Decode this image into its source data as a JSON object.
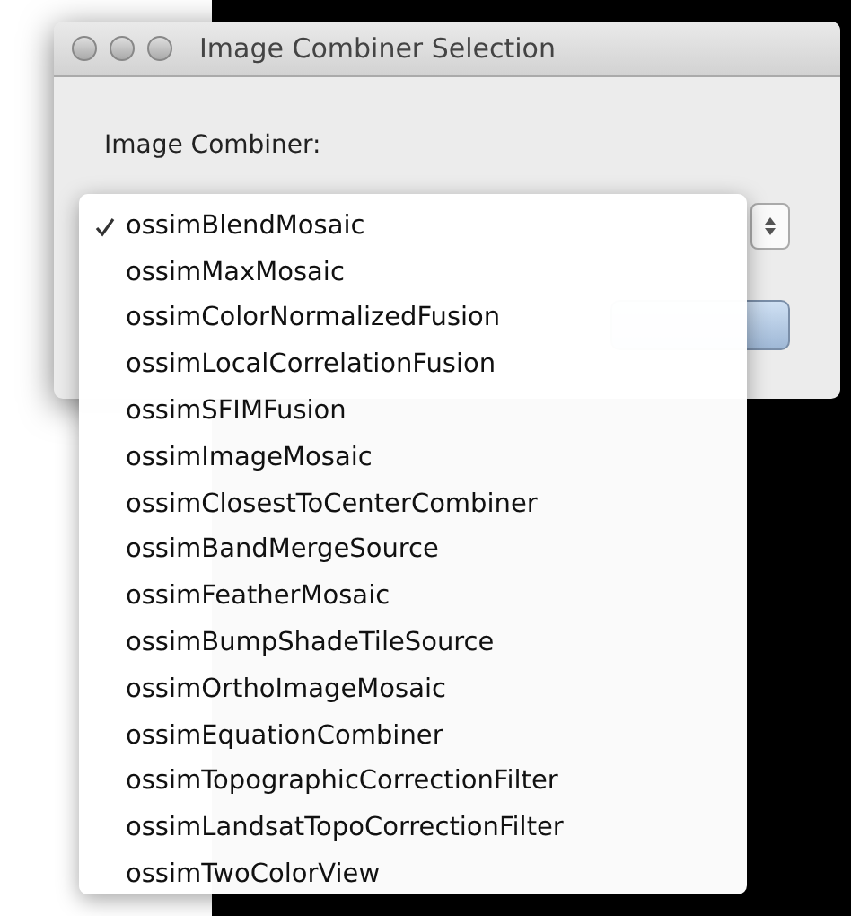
{
  "window": {
    "title": "Image Combiner Selection"
  },
  "label": "Image Combiner:",
  "menu_items": [
    {
      "label": "ossimBlendMosaic",
      "selected": true
    },
    {
      "label": "ossimMaxMosaic",
      "selected": false
    },
    {
      "label": "ossimColorNormalizedFusion",
      "selected": false
    },
    {
      "label": "ossimLocalCorrelationFusion",
      "selected": false
    },
    {
      "label": "ossimSFIMFusion",
      "selected": false
    },
    {
      "label": "ossimImageMosaic",
      "selected": false
    },
    {
      "label": "ossimClosestToCenterCombiner",
      "selected": false
    },
    {
      "label": "ossimBandMergeSource",
      "selected": false
    },
    {
      "label": "ossimFeatherMosaic",
      "selected": false
    },
    {
      "label": "ossimBumpShadeTileSource",
      "selected": false
    },
    {
      "label": "ossimOrthoImageMosaic",
      "selected": false
    },
    {
      "label": "ossimEquationCombiner",
      "selected": false
    },
    {
      "label": "ossimTopographicCorrectionFilter",
      "selected": false
    },
    {
      "label": "ossimLandsatTopoCorrectionFilter",
      "selected": false
    },
    {
      "label": "ossimTwoColorView",
      "selected": false
    }
  ]
}
